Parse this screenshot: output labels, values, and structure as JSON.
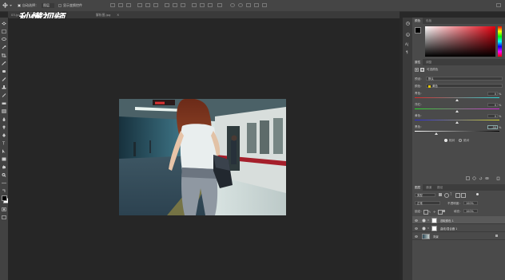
{
  "watermark": "秒懂视频",
  "options_bar": {
    "auto_select_label": "自动选择：",
    "auto_select_value": "图层",
    "transform_label": "显示变换控件"
  },
  "tabs": [
    {
      "label": "03.jpg",
      "active": false
    },
    {
      "label": "桌面_20 (RGB/8#)",
      "active": true
    },
    {
      "label": "解析图.jpg",
      "active": false
    }
  ],
  "color_panel": {
    "tabs": [
      "颜色",
      "色板"
    ]
  },
  "properties_panel": {
    "tabs": [
      "属性",
      "调整"
    ],
    "title": "可选颜色",
    "preset_label": "预设：",
    "preset_value": "默认",
    "colors_label": "颜色：",
    "colors_value": "黄色",
    "sliders": [
      {
        "label": "青色：",
        "value": "0",
        "unit": "%",
        "level": 0.5
      },
      {
        "label": "洋红：",
        "value": "0",
        "unit": "%",
        "level": 0.5
      },
      {
        "label": "黄色：",
        "value": "0",
        "unit": "%",
        "level": 0.5
      },
      {
        "label": "黑色：",
        "value": "-50",
        "unit": "%",
        "level": 0.25
      }
    ],
    "method_relative": "相对",
    "method_absolute": "绝对"
  },
  "layers_panel": {
    "tabs": [
      "图层",
      "通道",
      "路径"
    ],
    "kind_label": "类型",
    "blend_mode": "正常",
    "opacity_label": "不透明度：",
    "opacity_value": "100%",
    "lock_label": "锁定：",
    "fill_label": "填充：",
    "fill_value": "100%",
    "layers": [
      {
        "name": "选取颜色 1",
        "thumb": "white"
      },
      {
        "name": "曲线/混合器 1",
        "thumb": "white"
      },
      {
        "name": "背景",
        "thumb": "photo"
      }
    ]
  },
  "accent_colors": {
    "panel_bg": "#4a4a4a",
    "canvas_bg": "#262626",
    "selected_layer": "#5a5a5a",
    "swatch_yellow": "#e8c800"
  }
}
